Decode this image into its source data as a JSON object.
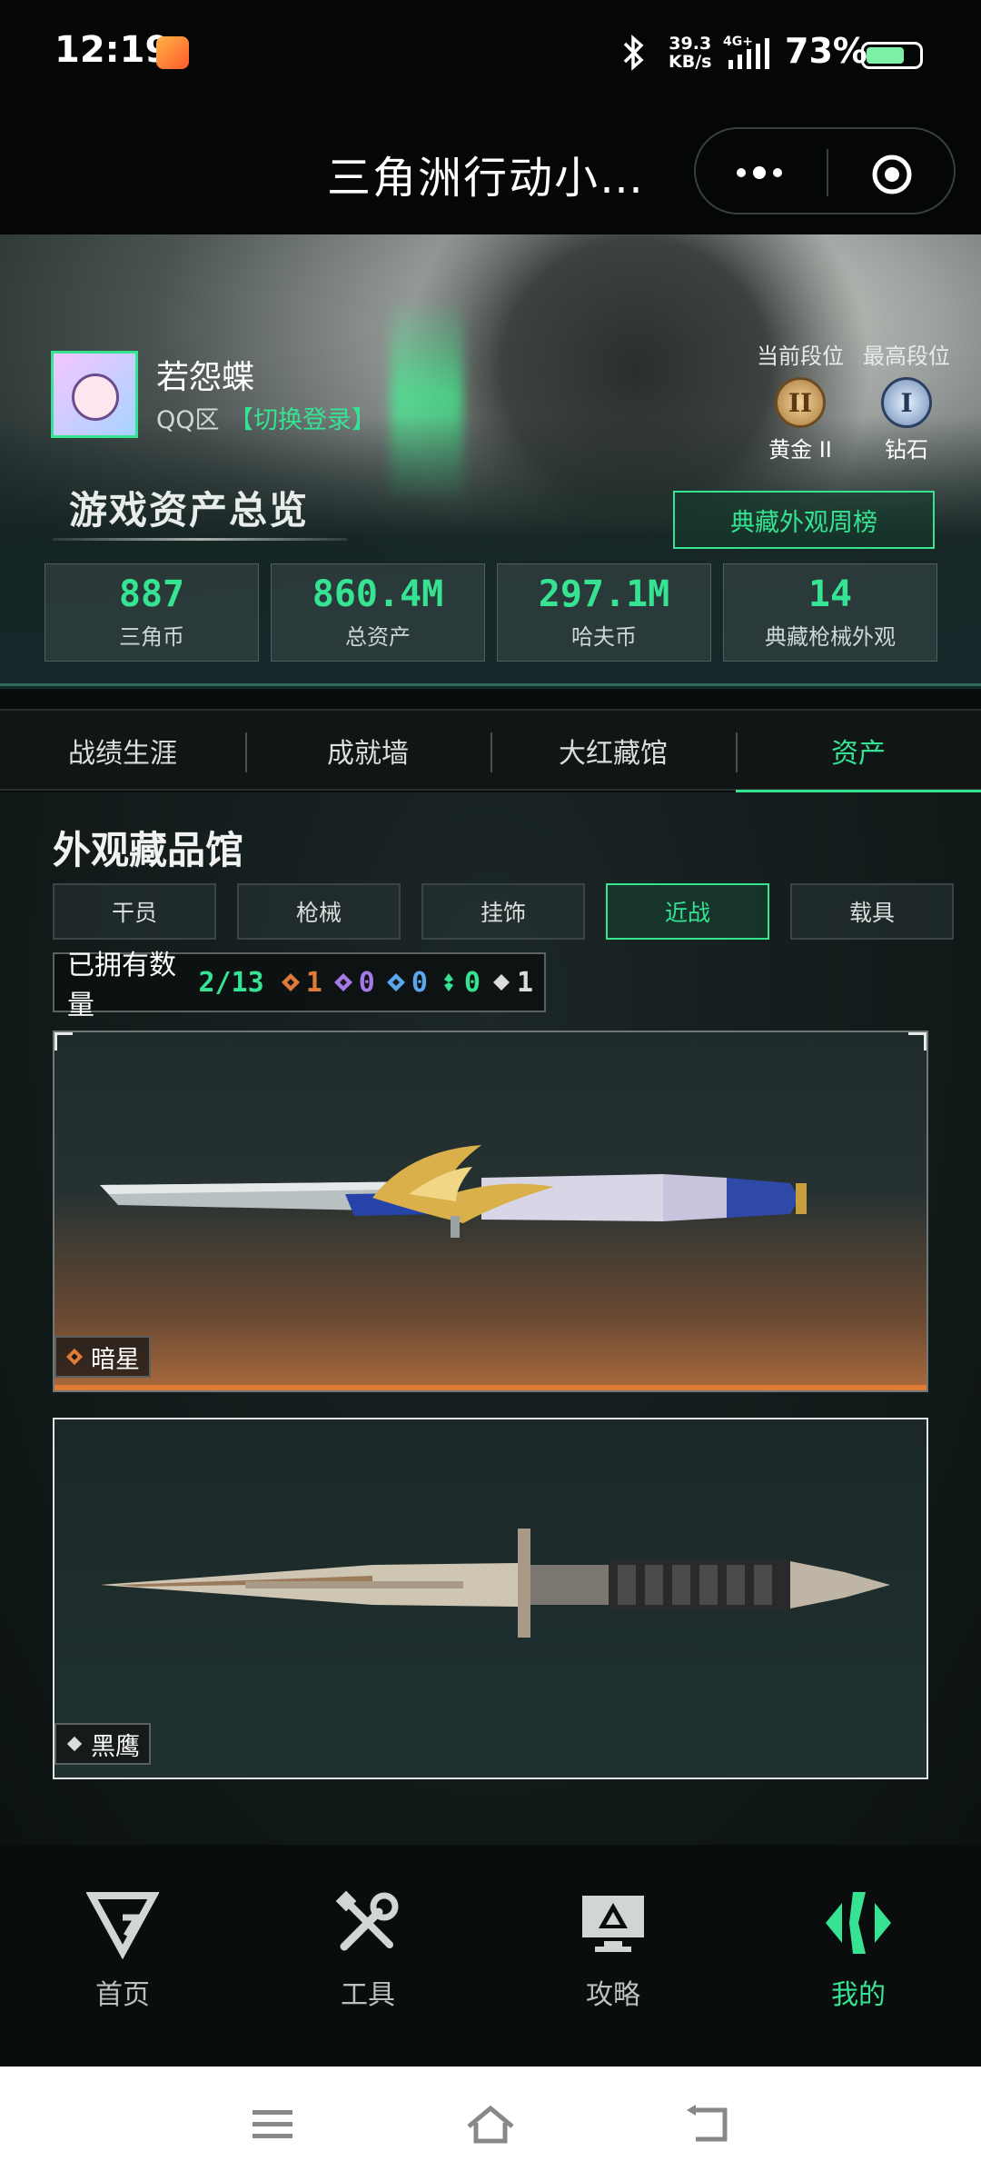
{
  "status_bar": {
    "time": "12:19",
    "net_speed_value": "39.3",
    "net_speed_unit": "KB/s",
    "network": "4G+",
    "battery": "73%",
    "battery_level": 0.73
  },
  "title_bar": {
    "title": "三角洲行动小…"
  },
  "profile": {
    "username": "若怨蝶",
    "region": "QQ区",
    "switch_login": "【切换登录】",
    "current_rank_title": "当前段位",
    "current_rank_badge": "II",
    "current_rank_name": "黄金 II",
    "highest_rank_title": "最高段位",
    "highest_rank_badge": "I",
    "highest_rank_name": "钻石"
  },
  "overview": {
    "title": "游戏资产总览",
    "ranking_button": "典藏外观周榜",
    "stats": [
      {
        "value": "887",
        "label": "三角币"
      },
      {
        "value": "860.4M",
        "label": "总资产"
      },
      {
        "value": "297.1M",
        "label": "哈夫币"
      },
      {
        "value": "14",
        "label": "典藏枪械外观"
      }
    ]
  },
  "tabs": [
    {
      "label": "战绩生涯",
      "active": false
    },
    {
      "label": "成就墙",
      "active": false
    },
    {
      "label": "大红藏馆",
      "active": false
    },
    {
      "label": "资产",
      "active": true
    }
  ],
  "collection": {
    "title": "外观藏品馆",
    "filters": [
      {
        "label": "干员",
        "active": false
      },
      {
        "label": "枪械",
        "active": false
      },
      {
        "label": "挂饰",
        "active": false
      },
      {
        "label": "近战",
        "active": true
      },
      {
        "label": "载具",
        "active": false
      }
    ],
    "owned_label": "已拥有数量",
    "owned_count": "2/13",
    "rarity_counts": [
      {
        "icon": "orange-diamond-icon",
        "count": "1",
        "color": "#e07a37"
      },
      {
        "icon": "purple-diamond-icon",
        "count": "0",
        "color": "#a678e8"
      },
      {
        "icon": "blue-diamond-icon",
        "count": "0",
        "color": "#5ba7ef"
      },
      {
        "icon": "green-diamond-icon",
        "count": "0",
        "color": "#36e393"
      },
      {
        "icon": "white-diamond-icon",
        "count": "1",
        "color": "#dcdcdc"
      }
    ],
    "items": [
      {
        "name": "暗星",
        "rarity_color": "#e07a37"
      },
      {
        "name": "黑鹰",
        "rarity_color": "#dcdcdc"
      }
    ]
  },
  "bottom_nav": [
    {
      "label": "首页",
      "icon": "home-logo-icon",
      "active": false
    },
    {
      "label": "工具",
      "icon": "tools-icon",
      "active": false
    },
    {
      "label": "攻略",
      "icon": "guide-monitor-icon",
      "active": false
    },
    {
      "label": "我的",
      "icon": "profile-logo-icon",
      "active": true
    }
  ],
  "colors": {
    "accent": "#36e393",
    "background": "#0a0d0d",
    "orange_rarity": "#e07a37"
  }
}
